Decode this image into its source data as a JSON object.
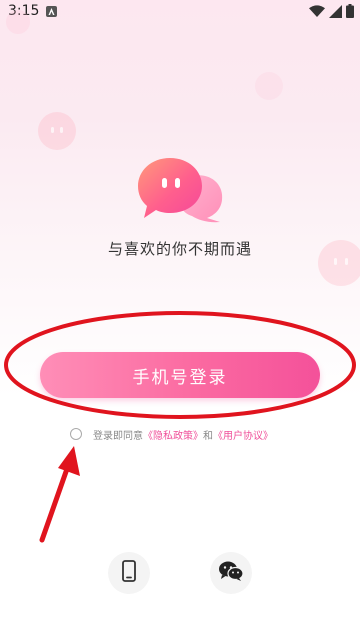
{
  "status_bar": {
    "time": "3:15",
    "notification_icon": "a-box-icon",
    "wifi_icon": "wifi-icon",
    "signal_icon": "cellular-signal-icon",
    "battery_icon": "battery-icon"
  },
  "colors": {
    "accent_pink": "#f4519a",
    "button_gradient_start": "#ff8eb7",
    "link_pink": "#f0509a",
    "annotation_red": "#e0141e"
  },
  "logo": {
    "icon": "chat-bubbles-logo-icon"
  },
  "slogan": "与喜欢的你不期而遇",
  "login_button": {
    "label": "手机号登录"
  },
  "agreement": {
    "prefix": "登录即同意",
    "privacy_policy": "《隐私政策》",
    "and": "和",
    "user_agreement": "《用户协议》"
  },
  "alt_logins": [
    {
      "name": "phone",
      "icon": "mobile-phone-icon"
    },
    {
      "name": "wechat",
      "icon": "wechat-icon"
    }
  ]
}
